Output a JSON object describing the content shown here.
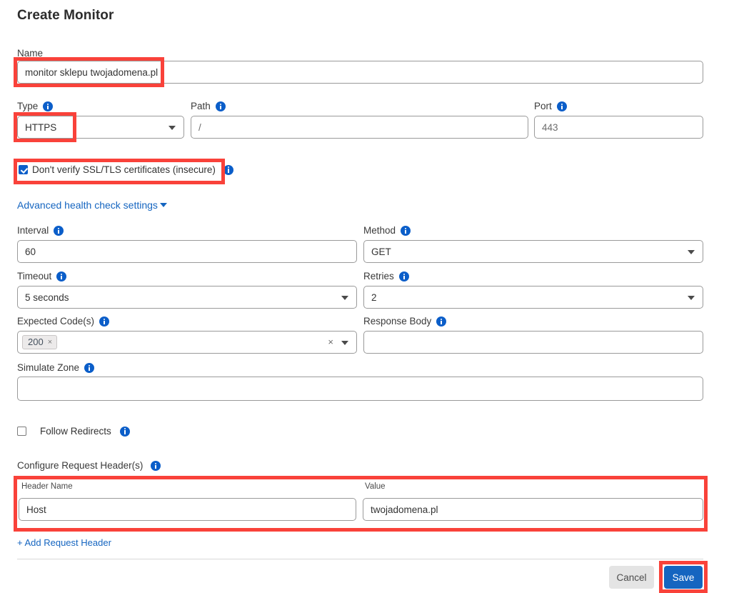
{
  "page": {
    "title": "Create Monitor"
  },
  "colors": {
    "accent": "#1565c0",
    "info_icon": "#0b5ec9",
    "highlight": "#f9423a",
    "save_button": "#1565c0",
    "cancel_button": "#e4e4e4"
  },
  "fields": {
    "name": {
      "label": "Name",
      "value": "monitor sklepu twojadomena.pl"
    },
    "type": {
      "label": "Type",
      "value": "HTTPS"
    },
    "path": {
      "label": "Path",
      "value": "/"
    },
    "port": {
      "label": "Port",
      "value": "443"
    },
    "ssl_checkbox": {
      "label": "Don't verify SSL/TLS certificates (insecure)",
      "checked": true
    },
    "advanced_toggle": {
      "label": "Advanced health check settings"
    },
    "interval": {
      "label": "Interval",
      "value": "60"
    },
    "method": {
      "label": "Method",
      "value": "GET"
    },
    "timeout": {
      "label": "Timeout",
      "value": "5 seconds"
    },
    "retries": {
      "label": "Retries",
      "value": "2"
    },
    "expected_codes": {
      "label": "Expected Code(s)",
      "chips": [
        {
          "text": "200",
          "remove": "×"
        }
      ],
      "clear_all": "×"
    },
    "response_body": {
      "label": "Response Body",
      "value": ""
    },
    "simulate_zone": {
      "label": "Simulate Zone",
      "value": ""
    },
    "follow_redirects": {
      "label": "Follow Redirects",
      "checked": false
    },
    "configure_headers": {
      "label": "Configure Request Header(s)"
    },
    "header_row": {
      "name_label": "Header Name",
      "name_value": "Host",
      "value_label": "Value",
      "value_value": "twojadomena.pl"
    },
    "add_header_link": "+ Add Request Header"
  },
  "footer": {
    "cancel_label": "Cancel",
    "save_label": "Save"
  }
}
